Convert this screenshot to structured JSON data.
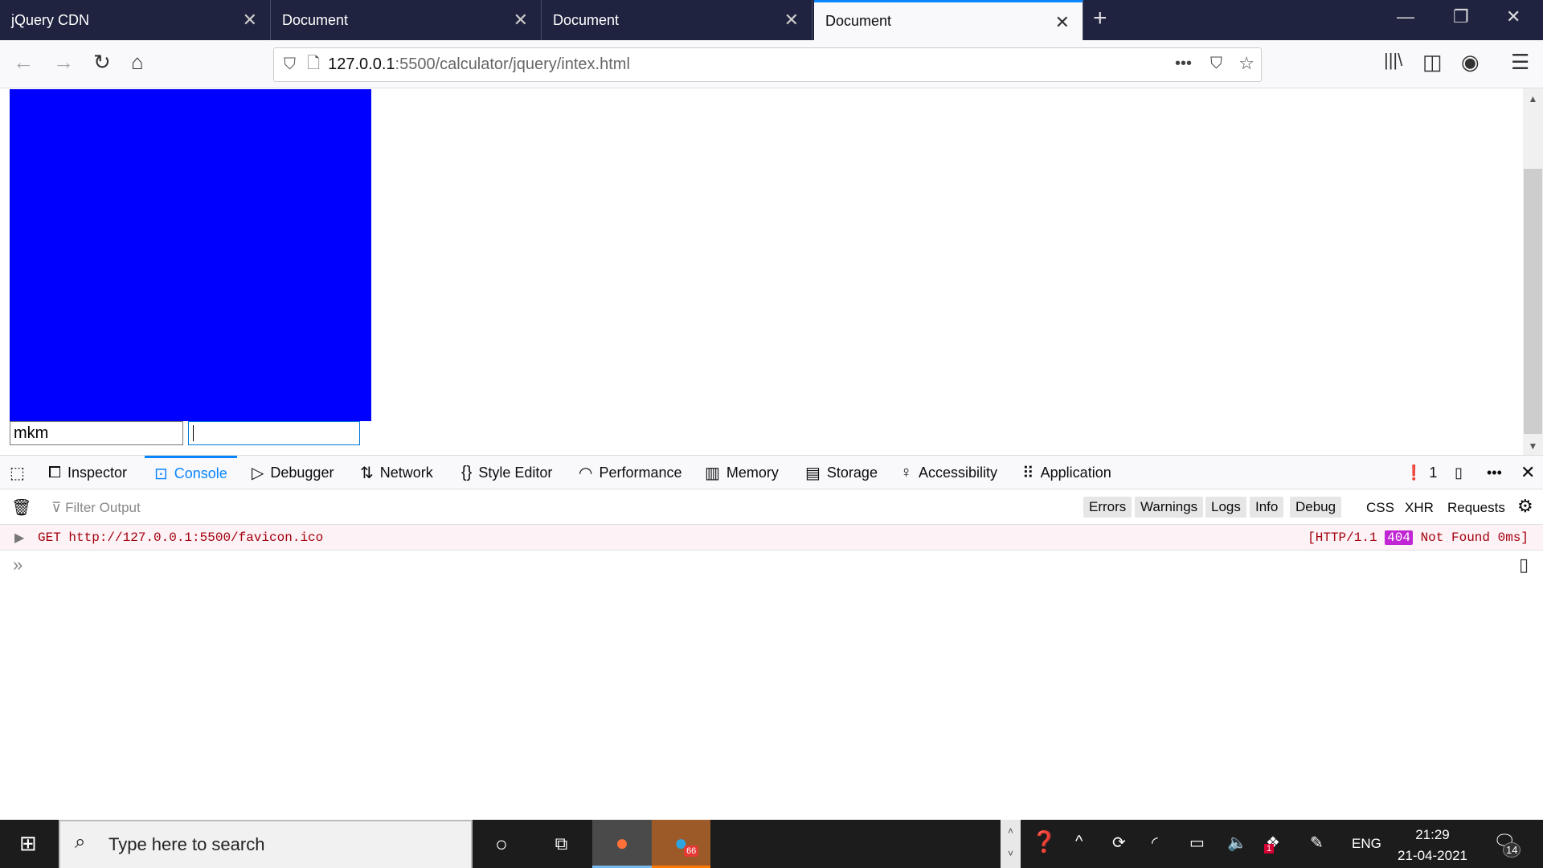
{
  "browser": {
    "tabs": [
      {
        "title": "jQuery CDN"
      },
      {
        "title": "Document"
      },
      {
        "title": "Document"
      },
      {
        "title": "Document",
        "active": true
      }
    ],
    "url_host": "127.0.0.1",
    "url_path": ":5500/calculator/jquery/intex.html"
  },
  "page": {
    "box_color": "#0000ff",
    "input1_value": "mkm",
    "input2_value": ""
  },
  "devtools": {
    "tabs": [
      "Inspector",
      "Console",
      "Debugger",
      "Network",
      "Style Editor",
      "Performance",
      "Memory",
      "Storage",
      "Accessibility",
      "Application"
    ],
    "active_tab": "Console",
    "error_count": "1",
    "filter_placeholder": "Filter Output",
    "filters": [
      "Errors",
      "Warnings",
      "Logs",
      "Info",
      "Debug"
    ],
    "filters2": [
      "CSS",
      "XHR",
      "Requests"
    ],
    "message": {
      "text": "GET http://127.0.0.1:5500/favicon.ico",
      "proto": "[HTTP/1.1",
      "status": "404",
      "status_text": "Not Found 0ms]"
    }
  },
  "taskbar": {
    "search_placeholder": "Type here to search",
    "telegram_badge": "66",
    "dropbox_badge": "1",
    "lang": "ENG",
    "time": "21:29",
    "date": "21-04-2021",
    "notifications": "14"
  }
}
